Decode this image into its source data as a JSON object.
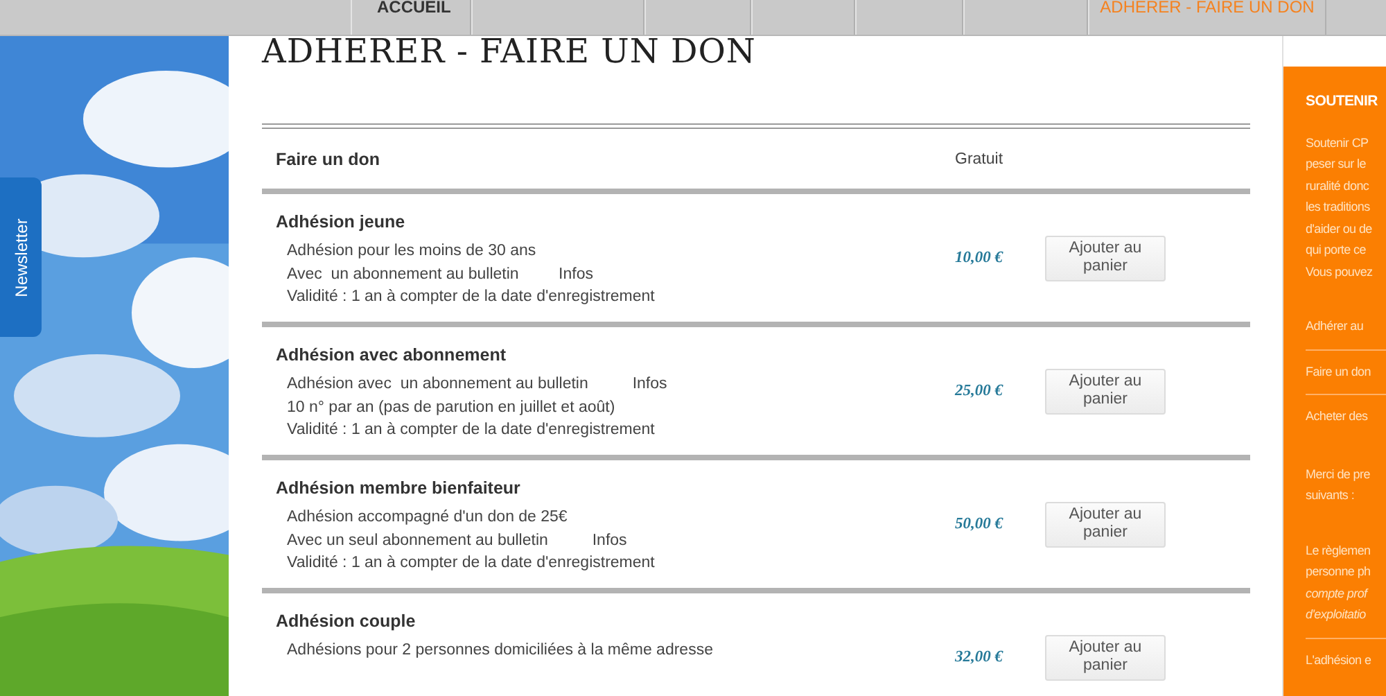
{
  "nav": {
    "tabs": [
      {
        "label": "ACCUEIL",
        "selected": false
      },
      {
        "selected": false
      },
      {
        "selected": false
      },
      {
        "selected": false
      },
      {
        "selected": false
      },
      {
        "selected": false
      },
      {
        "label": "ADHERER - FAIRE UN DON",
        "selected": true
      }
    ]
  },
  "newsletter_tab": {
    "label": "Newsletter"
  },
  "page_title": "ADHERER - FAIRE UN DON",
  "products": [
    {
      "kind": "header",
      "name": "Faire un don",
      "price": "Gratuit"
    },
    {
      "kind": "item",
      "name": "Adhésion jeune",
      "lines": [
        "Adhésion pour les moins de 30 ans",
        "Avec  un abonnement au bulletin         Infos",
        "Validité : 1 an à compter de la date d'enregistrement"
      ],
      "price": "10,00 €",
      "button": "Ajouter au panier"
    },
    {
      "kind": "item",
      "name": "Adhésion avec abonnement",
      "lines": [
        "Adhésion avec  un abonnement au bulletin          Infos",
        "10 n° par an (pas de parution en juillet et août)",
        "Validité : 1 an à compter de la date d'enregistrement"
      ],
      "price": "25,00 €",
      "button": "Ajouter au panier"
    },
    {
      "kind": "item",
      "name": "Adhésion membre bienfaiteur",
      "lines": [
        "Adhésion accompagné d'un don de 25€",
        "Avec un seul abonnement au bulletin          Infos",
        "Validité : 1 an à compter de la date d'enregistrement"
      ],
      "price": "50,00 €",
      "button": "Ajouter au panier"
    },
    {
      "kind": "item",
      "name": "Adhésion couple",
      "lines": [
        "Adhésions pour 2 personnes domiciliées à la même adresse"
      ],
      "price": "32,00 €",
      "button": "Ajouter au panier"
    }
  ],
  "sidebar": {
    "blocks": [
      {
        "kind": "heading",
        "lines": [
          "SOUTENIR"
        ]
      },
      {
        "kind": "text",
        "lines": [
          "Soutenir CP",
          "peser sur le",
          "ruralité donc",
          "les traditions",
          "d'aider ou de",
          "qui porte ce",
          "Vous pouvez"
        ]
      },
      {
        "kind": "link",
        "lines": [
          "Adhérer au"
        ]
      },
      {
        "kind": "link",
        "lines": [
          "Faire un don"
        ]
      },
      {
        "kind": "link",
        "lines": [
          "Acheter des"
        ]
      },
      {
        "kind": "text",
        "lines": [
          "Merci de pre",
          "suivants :"
        ]
      },
      {
        "kind": "mixed",
        "lines": [
          "Le règlemen",
          "personne ph"
        ],
        "italic_lines": [
          "compte prof",
          "d'exploitatio"
        ]
      },
      {
        "kind": "text",
        "lines": [
          "L'adhésion e"
        ]
      }
    ]
  }
}
